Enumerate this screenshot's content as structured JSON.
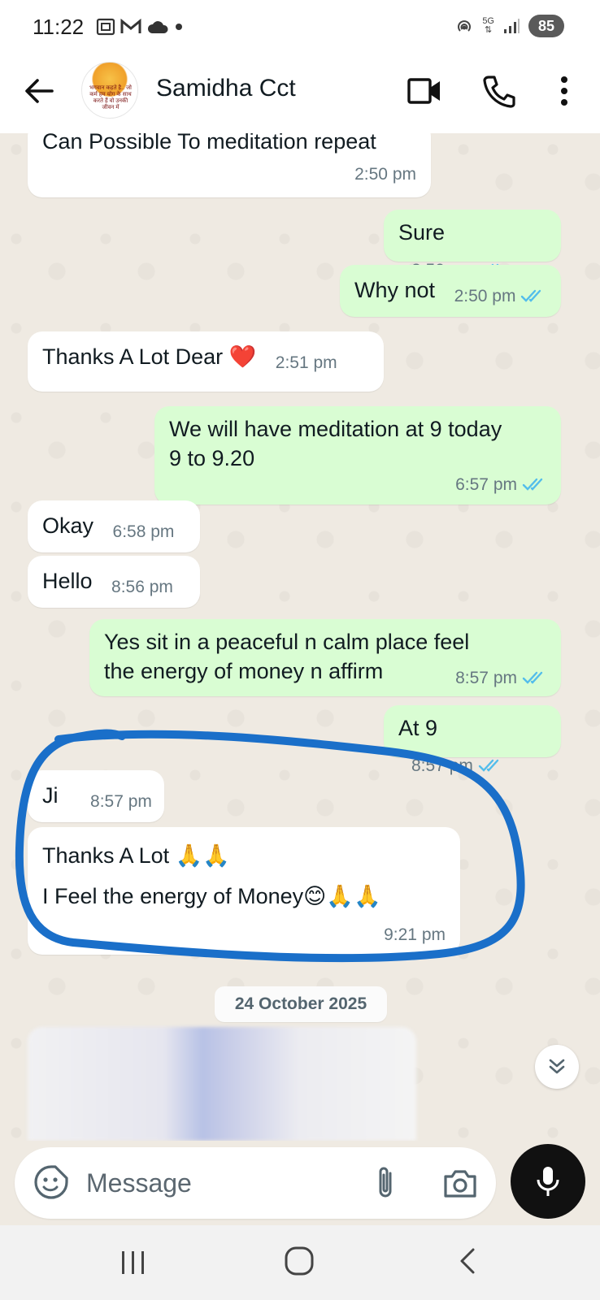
{
  "status_bar": {
    "time": "11:22",
    "network": "5G",
    "battery": "85",
    "icons_left": [
      "screenshot-icon",
      "gmail-icon",
      "cloud-icon",
      "dot-icon"
    ],
    "icons_right": [
      "hotspot-icon",
      "5g-icon",
      "signal-icon",
      "battery-icon"
    ]
  },
  "header": {
    "contact_name": "Samidha Cct",
    "avatar_text": "भगवान कहते है.. जो कर्म हम योग के साथ करते हैं वो उनकी जीवन में"
  },
  "messages": [
    {
      "dir": "in",
      "text": "Can Possible To meditation repeat",
      "time": "2:50 pm"
    },
    {
      "dir": "out",
      "text": "Sure",
      "time": "2:50 pm",
      "read": true
    },
    {
      "dir": "out",
      "text": "Why not",
      "time": "2:50 pm",
      "read": true
    },
    {
      "dir": "in",
      "text": "Thanks A Lot Dear ❤️",
      "time": "2:51 pm"
    },
    {
      "dir": "out",
      "text": "We will have meditation at 9 today\n9 to 9.20",
      "time": "6:57 pm",
      "read": true
    },
    {
      "dir": "in",
      "text": "Okay",
      "time": "6:58 pm"
    },
    {
      "dir": "in",
      "text": "Hello",
      "time": "8:56 pm"
    },
    {
      "dir": "out",
      "text": "Yes sit in a peaceful n calm place feel\nthe energy of money n affirm",
      "time": "8:57 pm",
      "read": true
    },
    {
      "dir": "out",
      "text": "At 9",
      "time": "8:57 pm",
      "read": true
    },
    {
      "dir": "in",
      "text": "Ji",
      "time": "8:57 pm"
    },
    {
      "dir": "in",
      "text": "Thanks A Lot 🙏🙏\nI Feel the energy of Money😊🙏🙏",
      "time": "9:21 pm"
    }
  ],
  "date_chip": "24 October 2025",
  "input": {
    "placeholder": "Message"
  },
  "colors": {
    "chat_bg": "#efeae2",
    "incoming_bubble": "#ffffff",
    "outgoing_bubble": "#d9fdd3",
    "read_ticks": "#53bdeb",
    "highlight_marker": "#1a6fc9",
    "mic_button": "#111111"
  }
}
